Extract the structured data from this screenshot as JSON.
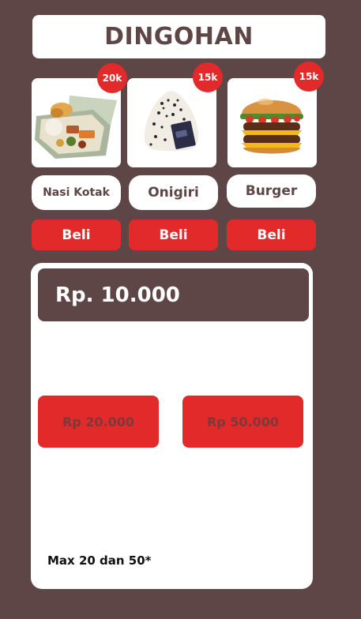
{
  "header": {
    "title": "DINGOHAN"
  },
  "products": [
    {
      "name": "Nasi Kotak",
      "badge": "20k",
      "buy_label": "Beli",
      "image_icon": "nasi-kotak-image"
    },
    {
      "name": "Onigiri",
      "badge": "15k",
      "buy_label": "Beli",
      "image_icon": "onigiri-image"
    },
    {
      "name": "Burger",
      "badge": "15k",
      "buy_label": "Beli",
      "image_icon": "burger-image"
    }
  ],
  "wallet": {
    "balance": "Rp. 10.000",
    "topup_options": [
      "Rp 20.000",
      "Rp 50.000"
    ],
    "note": "Max 20 dan 50*"
  },
  "colors": {
    "background": "#5e4646",
    "accent": "#e32a2a",
    "surface": "#ffffff"
  }
}
